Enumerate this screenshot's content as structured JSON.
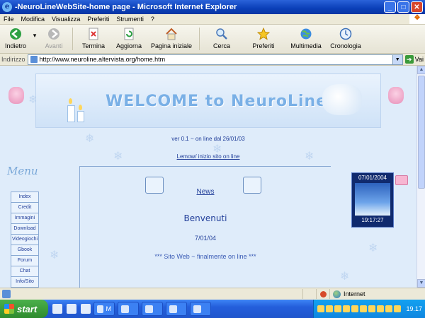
{
  "window": {
    "title": "-NeuroLineWebSite-home page - Microsoft Internet Explorer",
    "controls": {
      "minimize": "_",
      "maximize": "□",
      "close": "✕"
    }
  },
  "menu": [
    "File",
    "Modifica",
    "Visualizza",
    "Preferiti",
    "Strumenti",
    "?"
  ],
  "toolbar": {
    "back": "Indietro",
    "forward": "Avanti",
    "stop": "Termina",
    "refresh": "Aggiorna",
    "home": "Pagina iniziale",
    "search": "Cerca",
    "favorites": "Preferiti",
    "media": "Multimedia",
    "history": "Cronologia"
  },
  "address": {
    "label": "Indirizzo",
    "url": "http://www.neuroline.altervista.org/home.htm",
    "go": "Vai"
  },
  "page": {
    "banner_title": "WELCOME to NeuroLine",
    "version": "ver 0.1 ~ on line dal 26/01/03",
    "links": "Lemow/ inizio sito on line",
    "menu_title": "Menu",
    "menu_items": [
      "Index",
      "Credit",
      "Immagini",
      "Download",
      "Videogiochi",
      "Gbook",
      "Forum",
      "Chat",
      "Info/Sito"
    ],
    "news_title": "News",
    "welcome": "Benvenuti",
    "news_date": "7/01/04",
    "marquee": "*** Sito Web ~ finalmente on line ***",
    "widget_date": "07/01/2004",
    "widget_time": "19:17:27"
  },
  "status": {
    "zone": "Internet"
  },
  "taskbar": {
    "start": "start",
    "windows": [
      "M",
      "",
      "",
      "",
      ""
    ],
    "clock": "19.17"
  },
  "colors": {
    "titlebar": "#0a3fb8",
    "page_bg": "#dfecfa",
    "link": "#223f9a",
    "taskbar": "#245edb"
  }
}
